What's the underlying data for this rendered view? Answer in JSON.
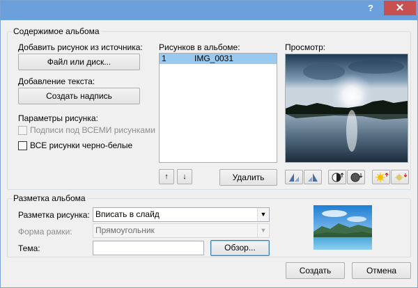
{
  "titlebar": {
    "help": "?",
    "close": "✕"
  },
  "album_content": {
    "group_label": "Содержимое альбома",
    "insert_from_label": "Добавить рисунок из источника:",
    "file_button": "Файл или диск...",
    "insert_text_label": "Добавление текста:",
    "new_textbox_button": "Создать надпись",
    "picture_options_label": "Параметры рисунка:",
    "captions_checkbox": "Подписи под ВСЕМИ рисунками",
    "bw_checkbox": "ВСЕ рисунки черно-белые",
    "pictures_label": "Рисунков в альбоме:",
    "pictures": [
      {
        "num": "1",
        "name": "IMG_0031"
      }
    ],
    "up_arrow": "↑",
    "down_arrow": "↓",
    "remove_button": "Удалить",
    "preview_label": "Просмотр:"
  },
  "layout_group": {
    "group_label": "Разметка альбома",
    "picture_layout_label": "Разметка рисунка:",
    "picture_layout_value": "Вписать в слайд",
    "frame_shape_label": "Форма рамки:",
    "frame_shape_value": "Прямоугольник",
    "theme_label": "Тема:",
    "theme_value": "",
    "browse_button": "Обзор..."
  },
  "footer": {
    "create_button": "Создать",
    "cancel_button": "Отмена"
  },
  "colors": {
    "title_bar": "#6ca0dc",
    "close": "#c75050",
    "selection": "#99c9ef"
  }
}
